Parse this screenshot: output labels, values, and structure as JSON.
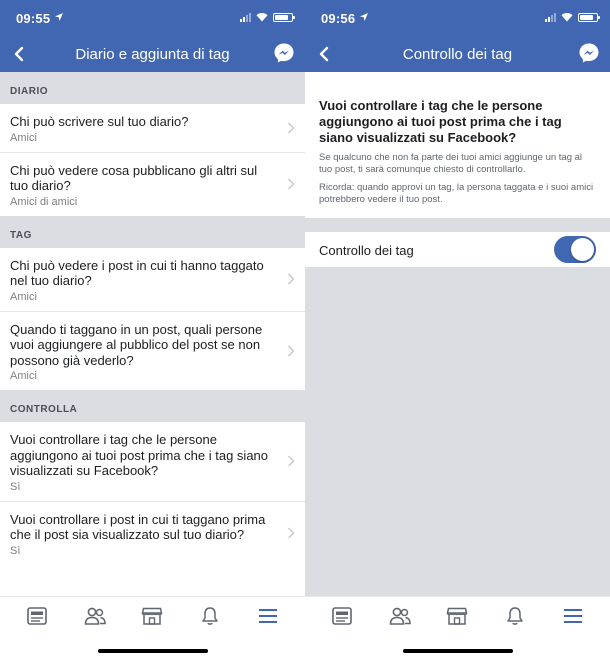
{
  "colors": {
    "brand": "#4267b2",
    "section_bg": "#dadde1",
    "active_tab": "#4267b2"
  },
  "left": {
    "status": {
      "time": "09:55",
      "location_icon": "location-arrow-icon"
    },
    "nav": {
      "title": "Diario e aggiunta di tag"
    },
    "sections": [
      {
        "header": "DIARIO",
        "rows": [
          {
            "question": "Chi può scrivere sul tuo diario?",
            "answer": "Amici"
          },
          {
            "question": "Chi può vedere cosa pubblicano gli altri sul tuo diario?",
            "answer": "Amici di amici"
          }
        ]
      },
      {
        "header": "TAG",
        "rows": [
          {
            "question": "Chi può vedere i post in cui ti hanno taggato nel tuo diario?",
            "answer": "Amici"
          },
          {
            "question": "Quando ti taggano in un post, quali persone vuoi aggiungere al pubblico del post se non possono già vederlo?",
            "answer": "Amici"
          }
        ]
      },
      {
        "header": "CONTROLLA",
        "rows": [
          {
            "question": "Vuoi controllare i tag che le persone aggiungono ai tuoi post prima che i tag siano visualizzati su Facebook?",
            "answer": "Sì"
          },
          {
            "question": "Vuoi controllare i post in cui ti taggano prima che il post sia visualizzato sul tuo diario?",
            "answer": "Sì"
          }
        ]
      }
    ]
  },
  "right": {
    "status": {
      "time": "09:56",
      "location_icon": "location-arrow-icon"
    },
    "nav": {
      "title": "Controllo dei tag"
    },
    "intro": {
      "heading": "Vuoi controllare i tag che le persone aggiungono ai tuoi post prima che i tag siano visualizzati su Facebook?",
      "p1": "Se qualcuno che non fa parte dei tuoi amici aggiunge un tag al tuo post, ti sarà comunque chiesto di controllarlo.",
      "p2": "Ricorda: quando approvi un tag, la persona taggata e i suoi amici potrebbero vedere il tuo post."
    },
    "toggle": {
      "label": "Controllo dei tag",
      "on": true
    }
  },
  "tabbar": {
    "icons": [
      "news-feed-icon",
      "friends-icon",
      "marketplace-icon",
      "notifications-bell-icon",
      "menu-icon"
    ],
    "active_index": 4
  }
}
